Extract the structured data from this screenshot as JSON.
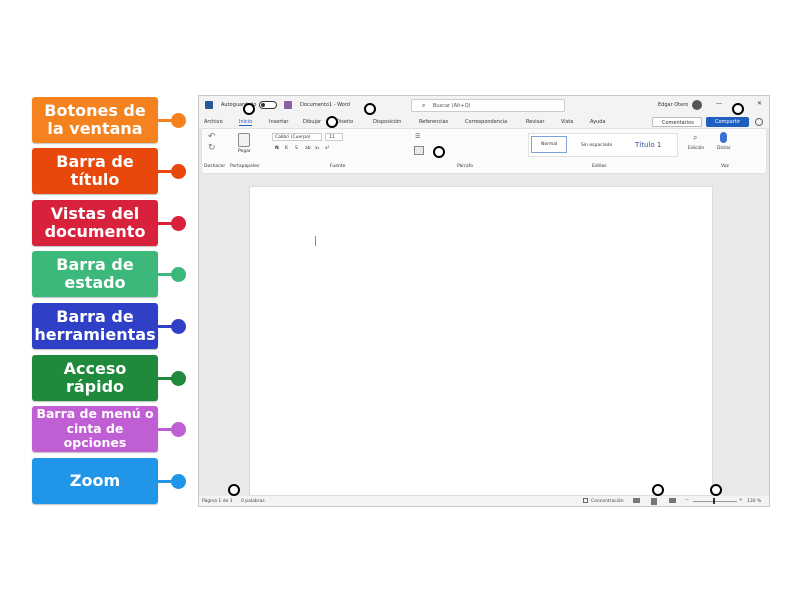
{
  "labels": [
    {
      "text": "Botones de la ventana",
      "color": "#f4821f",
      "dot": "#f4821f"
    },
    {
      "text": "Barra de título",
      "color": "#e8480c",
      "dot": "#e8480c"
    },
    {
      "text": "Vistas del documento",
      "color": "#d8213a",
      "dot": "#d8213a"
    },
    {
      "text": "Barra de estado",
      "color": "#3cb87a",
      "dot": "#3cb87a"
    },
    {
      "text": "Barra de herramientas",
      "color": "#2f3fc6",
      "dot": "#2f3fc6"
    },
    {
      "text": "Acceso rápido",
      "color": "#1f8a3c",
      "dot": "#1f8a3c"
    },
    {
      "text": "Barra de menú o cinta de opciones",
      "color": "#c05ed3",
      "dot": "#c05ed3"
    },
    {
      "text": "Zoom",
      "color": "#2196e8",
      "dot": "#2196e8"
    }
  ],
  "word": {
    "title": {
      "autosave": "Autoguardado",
      "doc_name": "Documento1 - Word",
      "search_placeholder": "Buscar (Alt+Q)",
      "user": "Edgar Otero",
      "minimize": "—",
      "close": "✕"
    },
    "menu": [
      "Archivo",
      "Inicio",
      "Insertar",
      "Dibujar",
      "Diseño",
      "Disposición",
      "Referencias",
      "Correspondencia",
      "Revisar",
      "Vista",
      "Ayuda"
    ],
    "comments_label": "Comentarios",
    "share_label": "Compartir",
    "ribbon": {
      "undo_group": "Deshacer",
      "clipboard_group": "Portapapeles",
      "paste": "Pegar",
      "font_name": "Calibri (Cuerpo)",
      "font_size": "11",
      "font_group": "Fuente",
      "paragraph_group": "Párrafo",
      "styles": [
        "Normal",
        "Sin espaciado",
        "Título 1"
      ],
      "styles_group": "Estilos",
      "edit_label": "Edición",
      "dictate_label": "Dictar",
      "voice_group": "Voz",
      "font_buttons": [
        "N",
        "K",
        "S",
        "ab",
        "x₂",
        "x²"
      ]
    },
    "status": {
      "page": "Página 1 de 1",
      "words": "0 palabras",
      "focus": "Concentración",
      "zoom": "130 %"
    }
  }
}
